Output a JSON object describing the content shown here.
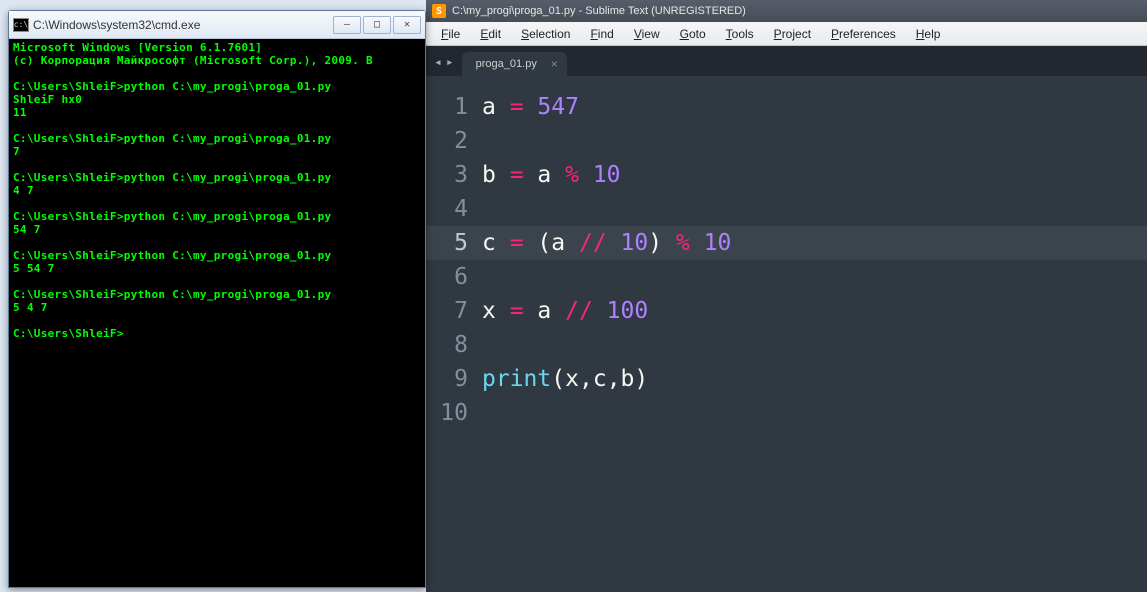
{
  "cmd": {
    "title": "C:\\Windows\\system32\\cmd.exe",
    "lines": [
      "Microsoft Windows [Version 6.1.7601]",
      "(c) Корпорация Майкрософт (Microsoft Corp.), 2009. В",
      "",
      "C:\\Users\\ShleiF>python C:\\my_progi\\proga_01.py",
      "ShleiF hx0",
      "11",
      "",
      "C:\\Users\\ShleiF>python C:\\my_progi\\proga_01.py",
      "7",
      "",
      "C:\\Users\\ShleiF>python C:\\my_progi\\proga_01.py",
      "4 7",
      "",
      "C:\\Users\\ShleiF>python C:\\my_progi\\proga_01.py",
      "54 7",
      "",
      "C:\\Users\\ShleiF>python C:\\my_progi\\proga_01.py",
      "5 54 7",
      "",
      "C:\\Users\\ShleiF>python C:\\my_progi\\proga_01.py",
      "5 4 7",
      "",
      "C:\\Users\\ShleiF>"
    ]
  },
  "sublime": {
    "title": "C:\\my_progi\\proga_01.py - Sublime Text (UNREGISTERED)",
    "menus": [
      "File",
      "Edit",
      "Selection",
      "Find",
      "View",
      "Goto",
      "Tools",
      "Project",
      "Preferences",
      "Help"
    ],
    "tab": "proga_01.py",
    "active_line": 5,
    "code": [
      [
        [
          "var",
          "a "
        ],
        [
          "op",
          "= "
        ],
        [
          "num",
          "547"
        ]
      ],
      [],
      [
        [
          "var",
          "b "
        ],
        [
          "op",
          "= "
        ],
        [
          "var",
          "a "
        ],
        [
          "op",
          "% "
        ],
        [
          "num",
          "10"
        ]
      ],
      [],
      [
        [
          "var",
          "c "
        ],
        [
          "op",
          "= "
        ],
        [
          "paren",
          "("
        ],
        [
          "var",
          "a "
        ],
        [
          "op",
          "// "
        ],
        [
          "num",
          "10"
        ],
        [
          "paren",
          ") "
        ],
        [
          "op",
          "% "
        ],
        [
          "num",
          "10"
        ]
      ],
      [],
      [
        [
          "var",
          "x "
        ],
        [
          "op",
          "= "
        ],
        [
          "var",
          "a "
        ],
        [
          "op",
          "// "
        ],
        [
          "num",
          "100"
        ]
      ],
      [],
      [
        [
          "func",
          "print"
        ],
        [
          "paren",
          "("
        ],
        [
          "var",
          "x"
        ],
        [
          "comma",
          ","
        ],
        [
          "var",
          "c"
        ],
        [
          "comma",
          ","
        ],
        [
          "var",
          "b"
        ],
        [
          "paren",
          ")"
        ]
      ],
      []
    ]
  }
}
